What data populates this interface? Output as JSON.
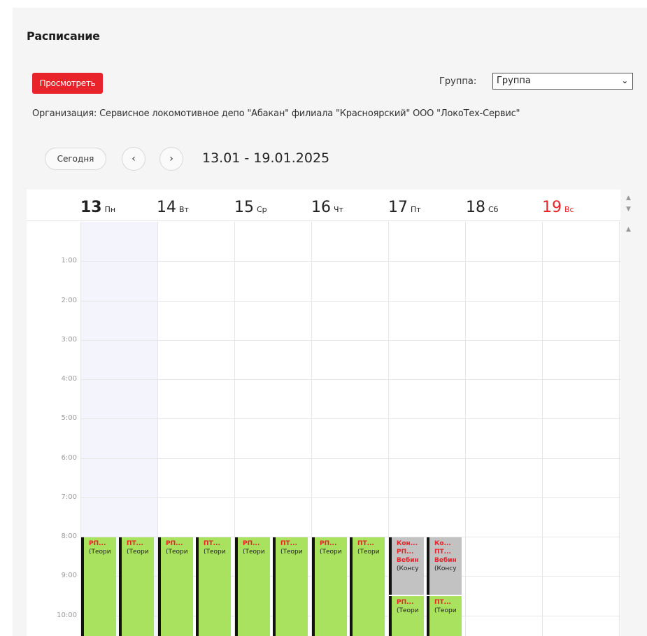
{
  "page": {
    "title": "Расписание",
    "view_button": "Просмотреть",
    "group_label": "Группа:",
    "group_value": "Группа",
    "organization": "Организация: Сервисное локомотивное депо \"Абакан\" филиала \"Красноярский\" ООО \"ЛокоТех-Сервис\""
  },
  "toolbar": {
    "today_label": "Сегодня",
    "prev_icon": "chevron-left-icon",
    "next_icon": "chevron-right-icon",
    "prev_glyph": "‹",
    "next_glyph": "›",
    "range": "13.01 - 19.01.2025"
  },
  "days": [
    {
      "num": "13",
      "wd": "Пн",
      "today": true
    },
    {
      "num": "14",
      "wd": "Вт"
    },
    {
      "num": "15",
      "wd": "Ср"
    },
    {
      "num": "16",
      "wd": "Чт"
    },
    {
      "num": "17",
      "wd": "Пт"
    },
    {
      "num": "18",
      "wd": "Сб"
    },
    {
      "num": "19",
      "wd": "Вс",
      "sunday": true
    }
  ],
  "hours": [
    "1:00",
    "2:00",
    "3:00",
    "4:00",
    "5:00",
    "6:00",
    "7:00",
    "8:00",
    "9:00",
    "10:00"
  ],
  "events": [
    {
      "day": 0,
      "slot": 0,
      "start": 8,
      "end": 10.6,
      "color": "green",
      "lines": [
        "РП...",
        "(Теори"
      ]
    },
    {
      "day": 0,
      "slot": 1,
      "start": 8,
      "end": 10.6,
      "color": "green",
      "lines": [
        "ПТ...",
        "(Теори"
      ]
    },
    {
      "day": 1,
      "slot": 0,
      "start": 8,
      "end": 10.6,
      "color": "green",
      "lines": [
        "РП...",
        "(Теори"
      ]
    },
    {
      "day": 1,
      "slot": 1,
      "start": 8,
      "end": 10.6,
      "color": "green",
      "lines": [
        "ПТ...",
        "(Теори"
      ]
    },
    {
      "day": 2,
      "slot": 0,
      "start": 8,
      "end": 10.6,
      "color": "green",
      "lines": [
        "РП...",
        "(Теори"
      ]
    },
    {
      "day": 2,
      "slot": 1,
      "start": 8,
      "end": 10.6,
      "color": "green",
      "lines": [
        "ПТ...",
        "(Теори"
      ]
    },
    {
      "day": 3,
      "slot": 0,
      "start": 8,
      "end": 10.6,
      "color": "green",
      "lines": [
        "РП...",
        "(Теори"
      ]
    },
    {
      "day": 3,
      "slot": 1,
      "start": 8,
      "end": 10.6,
      "color": "green",
      "lines": [
        "ПТ...",
        "(Теори"
      ]
    },
    {
      "day": 4,
      "slot": 0,
      "start": 8,
      "end": 9.5,
      "color": "gray",
      "lines": [
        "Кон...",
        "РП...",
        "Вебин",
        "(Консу"
      ],
      "red_count": 3
    },
    {
      "day": 4,
      "slot": 1,
      "start": 8,
      "end": 9.5,
      "color": "gray",
      "lines": [
        "Ко...",
        "ПТ...",
        "Вебин",
        "(Консу"
      ],
      "red_count": 3
    },
    {
      "day": 4,
      "slot": 0,
      "start": 9.5,
      "end": 10.6,
      "color": "green",
      "lines": [
        "РП...",
        "(Теори"
      ]
    },
    {
      "day": 4,
      "slot": 1,
      "start": 9.5,
      "end": 10.6,
      "color": "green",
      "lines": [
        "ПТ...",
        "(Теори"
      ]
    }
  ],
  "colors": {
    "accent": "#e8242a",
    "event_green": "#a9e25f",
    "event_gray": "#c2c2c2",
    "today_bg": "#f3f4fc"
  }
}
